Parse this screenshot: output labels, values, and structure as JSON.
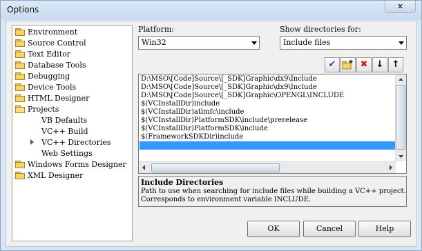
{
  "window": {
    "title": "Options",
    "close_glyph": "x"
  },
  "tree": {
    "items": [
      {
        "label": "Environment",
        "type": "folder"
      },
      {
        "label": "Source Control",
        "type": "folder"
      },
      {
        "label": "Text Editor",
        "type": "folder"
      },
      {
        "label": "Database Tools",
        "type": "folder"
      },
      {
        "label": "Debugging",
        "type": "folder"
      },
      {
        "label": "Device Tools",
        "type": "folder"
      },
      {
        "label": "HTML Designer",
        "type": "folder"
      },
      {
        "label": "Projects",
        "type": "folder-open"
      },
      {
        "label": "VB Defaults",
        "type": "child"
      },
      {
        "label": "VC++ Build",
        "type": "child"
      },
      {
        "label": "VC++ Directories",
        "type": "child-selected"
      },
      {
        "label": "Web Settings",
        "type": "child"
      },
      {
        "label": "Windows Forms Designer",
        "type": "folder"
      },
      {
        "label": "XML Designer",
        "type": "folder"
      }
    ]
  },
  "platform": {
    "label": "Platform:",
    "value": "Win32"
  },
  "show_dirs": {
    "label": "Show directories for:",
    "value": "Include files"
  },
  "toolbar": {
    "check_glyph": "✔",
    "new_folder_icon": "new-folder-icon",
    "delete_glyph": "✖",
    "down_glyph": "↓",
    "up_glyph": "↑"
  },
  "directories": [
    "D:\\MSO\\[Code]Source\\[_SDK]Graphic\\dx9\\Include",
    "D:\\MSO\\[Code]Source\\[_SDK]Graphic\\dx9\\Include",
    "D:\\MSO\\[Code]Source\\[_SDK]Graphic\\OPENGL\\INCLUDE",
    "$(VCInstallDir)include",
    "$(VCInstallDir)atlmfc\\include",
    "$(VCInstallDir)PlatformSDK\\include\\prerelease",
    "$(VCInstallDir)PlatformSDK\\include",
    "$(FrameworkSDKDir)include",
    ""
  ],
  "description": {
    "title": "Include Directories",
    "line1": "Path to use when searching for include files while building a VC++ project.",
    "line2": "Corresponds to environment variable INCLUDE."
  },
  "buttons": {
    "ok": "OK",
    "cancel": "Cancel",
    "help": "Help"
  },
  "colors": {
    "selection": "#3399ff",
    "title_bg": "#d3e3f4"
  }
}
